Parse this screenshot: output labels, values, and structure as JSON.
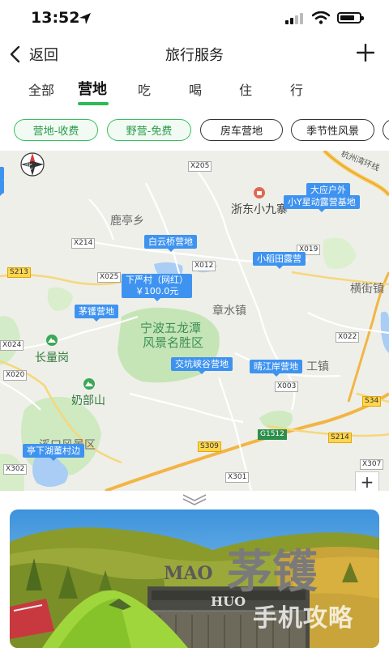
{
  "status": {
    "time": "13:52"
  },
  "nav": {
    "back_label": "返回",
    "title": "旅行服务"
  },
  "tabs": [
    "全部",
    "营地",
    "吃",
    "喝",
    "住",
    "行"
  ],
  "active_tab": "营地",
  "filters": [
    "营地-收费",
    "野营-免费",
    "房车营地",
    "季节性风景"
  ],
  "map": {
    "places": [
      "鹿亭乡",
      "章水镇",
      "横街镇",
      "长量岗",
      "奶部山",
      "浙东小九寨",
      "宁波五龙潭",
      "风景名胜区",
      "工镇",
      "溪口风景区",
      "杭州湾环线"
    ],
    "roads": [
      "X205",
      "X214",
      "X012",
      "X025",
      "S213",
      "X019",
      "X024",
      "X020",
      "X022",
      "X003",
      "S34",
      "G1512",
      "S309",
      "S214",
      "X302",
      "X301",
      "X307"
    ],
    "markers": [
      {
        "name": "大应户外"
      },
      {
        "name": "小Y星动露营基地"
      },
      {
        "name": "白云桥营地"
      },
      {
        "name": "小稻田露营"
      },
      {
        "name": "下严村（网红）",
        "price": "￥100.0元"
      },
      {
        "name": "茅镬营地"
      },
      {
        "name": "交坑峡谷营地"
      },
      {
        "name": "晴江岸营地"
      },
      {
        "name": "亭下湖董村边"
      }
    ],
    "compass_label": "北",
    "zoom_in": "+"
  },
  "card": {
    "sign_main": "茅镬",
    "sign_small": "HUO",
    "sign_pinyin": "MAO",
    "watermark": "手机攻略"
  },
  "colors": {
    "accent": "#2bbb54",
    "marker": "#3f93f0"
  }
}
